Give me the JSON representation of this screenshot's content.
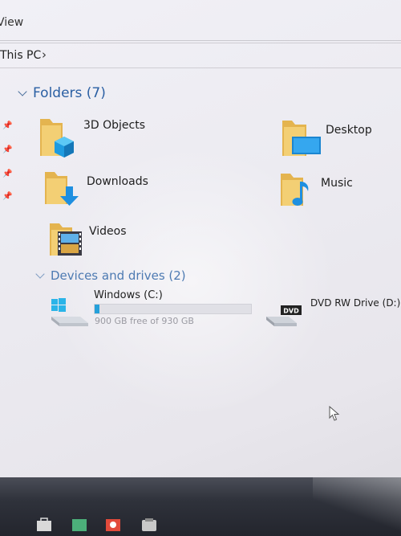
{
  "menu": {
    "view_label": "View"
  },
  "address": {
    "crumb": "This PC",
    "separator": "›"
  },
  "folders_group": {
    "title": "Folders (7)",
    "items": [
      {
        "label": "3D Objects",
        "icon": "3d-objects-folder-icon"
      },
      {
        "label": "Desktop",
        "icon": "desktop-folder-icon"
      },
      {
        "label": "Downloads",
        "icon": "downloads-folder-icon"
      },
      {
        "label": "Music",
        "icon": "music-folder-icon"
      },
      {
        "label": "Videos",
        "icon": "videos-folder-icon"
      }
    ]
  },
  "devices_group": {
    "title": "Devices and drives (2)",
    "drives": [
      {
        "label": "Windows (C:)",
        "free_text": "900 GB free of 930 GB",
        "used_fraction": 0.032,
        "icon": "windows-drive-icon"
      },
      {
        "label": "DVD RW Drive (D:)",
        "icon": "dvd-drive-icon",
        "badge": "DVD"
      }
    ]
  },
  "colors": {
    "accent": "#2a5fa3",
    "drive_bar": "#26a0da",
    "folder": "#f0c35e",
    "taskbar": "#2f323b"
  }
}
